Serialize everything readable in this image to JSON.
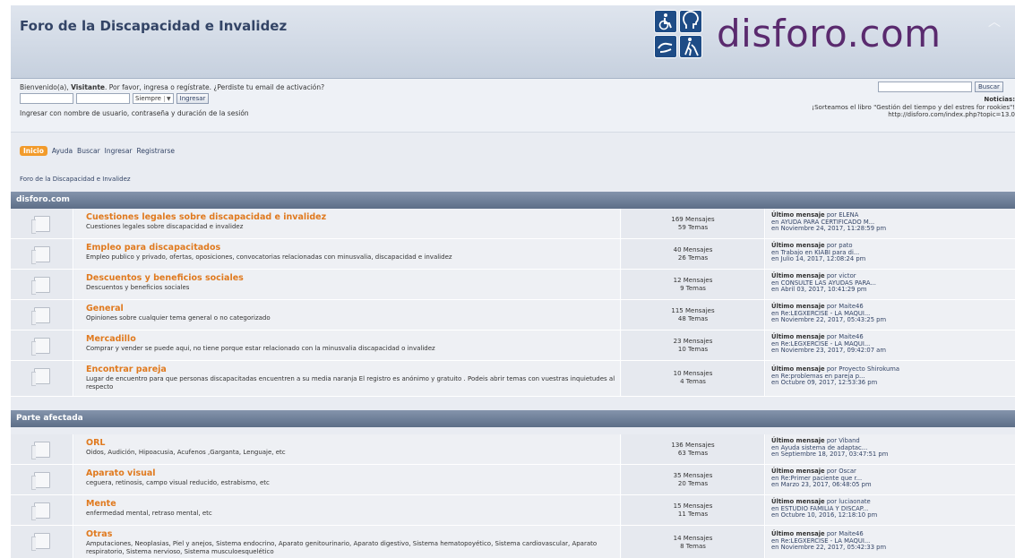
{
  "header": {
    "title": "Foro de la Discapacidad e Invalidez",
    "logo_text": "disforo.com",
    "collapse_icon": "chevron-up-icon"
  },
  "user": {
    "welcome_prefix": "Bienvenido(a),",
    "visitor": "Visitante",
    "welcome_rest": ". Por favor, ingresa o regístrate. ¿Perdiste tu email de activación?",
    "username_value": "",
    "password_value": "",
    "duration_select": "Siempre",
    "login_button": "Ingresar",
    "login_hint": "Ingresar con nombre de usuario, contraseña y duración de la sesión"
  },
  "search": {
    "value": "",
    "button": "Buscar"
  },
  "news": {
    "title": "Noticias:",
    "line1": "¡Sorteamos el libro \"Gestión del tiempo y del estres for rookies\"!",
    "line2": "http://disforo.com/index.php?topic=13.0"
  },
  "menu": {
    "items": [
      "Inicio",
      "Ayuda",
      "Buscar",
      "Ingresar",
      "Registrarse"
    ]
  },
  "breadcrumb": "Foro de la Discapacidad e Invalidez",
  "colors": {
    "accent": "#f29b2b",
    "board_title": "#e07a1f",
    "cat_header": "#5d6e87"
  },
  "categories": [
    {
      "name": "disforo.com",
      "boards": [
        {
          "title": "Cuestiones legales sobre discapacidad e invalidez",
          "desc": "Cuestiones legales sobre discapacidad e invalidez",
          "posts": "169 Mensajes",
          "topics": "59 Temas",
          "last_label": "Último mensaje",
          "last_by": "por ELENA",
          "last_in": "en AYUDA PARA CERTIFICADO M...",
          "last_date": "en Noviembre 24, 2017, 11:28:59 pm"
        },
        {
          "title": "Empleo para discapacitados",
          "desc": "Empleo publico y privado, ofertas, oposiciones, convocatorias relacionadas con minusvalia, discapacidad e invalidez",
          "posts": "40 Mensajes",
          "topics": "26 Temas",
          "last_label": "Último mensaje",
          "last_by": "por pato",
          "last_in": "en Trabajo en KIABI para di...",
          "last_date": "en Julio 14, 2017, 12:08:24 pm"
        },
        {
          "title": "Descuentos y beneficios sociales",
          "desc": "Descuentos y beneficios sociales",
          "posts": "12 Mensajes",
          "topics": "9 Temas",
          "last_label": "Último mensaje",
          "last_by": "por victor",
          "last_in": "en CONSULTE LAS AYUDAS PARA...",
          "last_date": "en Abril 03, 2017, 10:41:29 pm"
        },
        {
          "title": "General",
          "desc": "Opiniones sobre cualquier tema general o no categorizado",
          "posts": "115 Mensajes",
          "topics": "48 Temas",
          "last_label": "Último mensaje",
          "last_by": "por Maite46",
          "last_in": "en Re:LEGXERCISE - LA MAQUI...",
          "last_date": "en Noviembre 22, 2017, 05:43:25 pm"
        },
        {
          "title": "Mercadillo",
          "desc": "Comprar y vender se puede aqui, no tiene porque estar relacionado con la minusvalia discapacidad o invalidez",
          "posts": "23 Mensajes",
          "topics": "10 Temas",
          "last_label": "Último mensaje",
          "last_by": "por Maite46",
          "last_in": "en Re:LEGXERCISE - LA MAQUI...",
          "last_date": "en Noviembre 23, 2017, 09:42:07 am"
        },
        {
          "title": "Encontrar pareja",
          "desc": "Lugar de encuentro para que personas discapacitadas encuentren a su media naranja El registro es anónimo y gratuito . Podeis abrir temas con vuestras inquietudes al respecto",
          "posts": "10 Mensajes",
          "topics": "4 Temas",
          "last_label": "Último mensaje",
          "last_by": "por Proyecto Shirokuma",
          "last_in": "en Re:problemas en pareja p...",
          "last_date": "en Octubre 09, 2017, 12:53:36 pm"
        }
      ]
    },
    {
      "name": "Parte afectada",
      "boards": [
        {
          "title": "ORL",
          "desc": "Oidos, Audición, Hipoacusia, Acufenos ,Garganta, Lenguaje, etc",
          "posts": "136 Mensajes",
          "topics": "63 Temas",
          "last_label": "Último mensaje",
          "last_by": "por Viband",
          "last_in": "en Ayuda sistema de adaptac...",
          "last_date": "en Septiembre 18, 2017, 03:47:51 pm"
        },
        {
          "title": "Aparato visual",
          "desc": "ceguera, retinosis, campo visual reducido, estrabismo, etc",
          "posts": "35 Mensajes",
          "topics": "20 Temas",
          "last_label": "Último mensaje",
          "last_by": "por Oscar",
          "last_in": "en Re:Primer paciente que r...",
          "last_date": "en Marzo 23, 2017, 06:48:05 pm"
        },
        {
          "title": "Mente",
          "desc": "enfermedad mental, retraso mental, etc",
          "posts": "15 Mensajes",
          "topics": "11 Temas",
          "last_label": "Último mensaje",
          "last_by": "por luciaonate",
          "last_in": "en ESTUDIO FAMILIA Y DISCAP...",
          "last_date": "en Octubre 10, 2016, 12:18:10 pm"
        },
        {
          "title": "Otras",
          "desc": "Amputaciones, Neoplasias, Piel y anejos, Sistema endocrino, Aparato genitourinario, Aparato digestivo, Sistema hematopoyético, Sistema cardiovascular, Aparato respiratorio, Sistema nervioso, Sistema musculoesquelético",
          "posts": "14 Mensajes",
          "topics": "8 Temas",
          "last_label": "Último mensaje",
          "last_by": "por Maite46",
          "last_in": "en Re:LEGXERCISE - LA MAQUI...",
          "last_date": "en Noviembre 22, 2017, 05:42:33 pm"
        }
      ]
    }
  ]
}
